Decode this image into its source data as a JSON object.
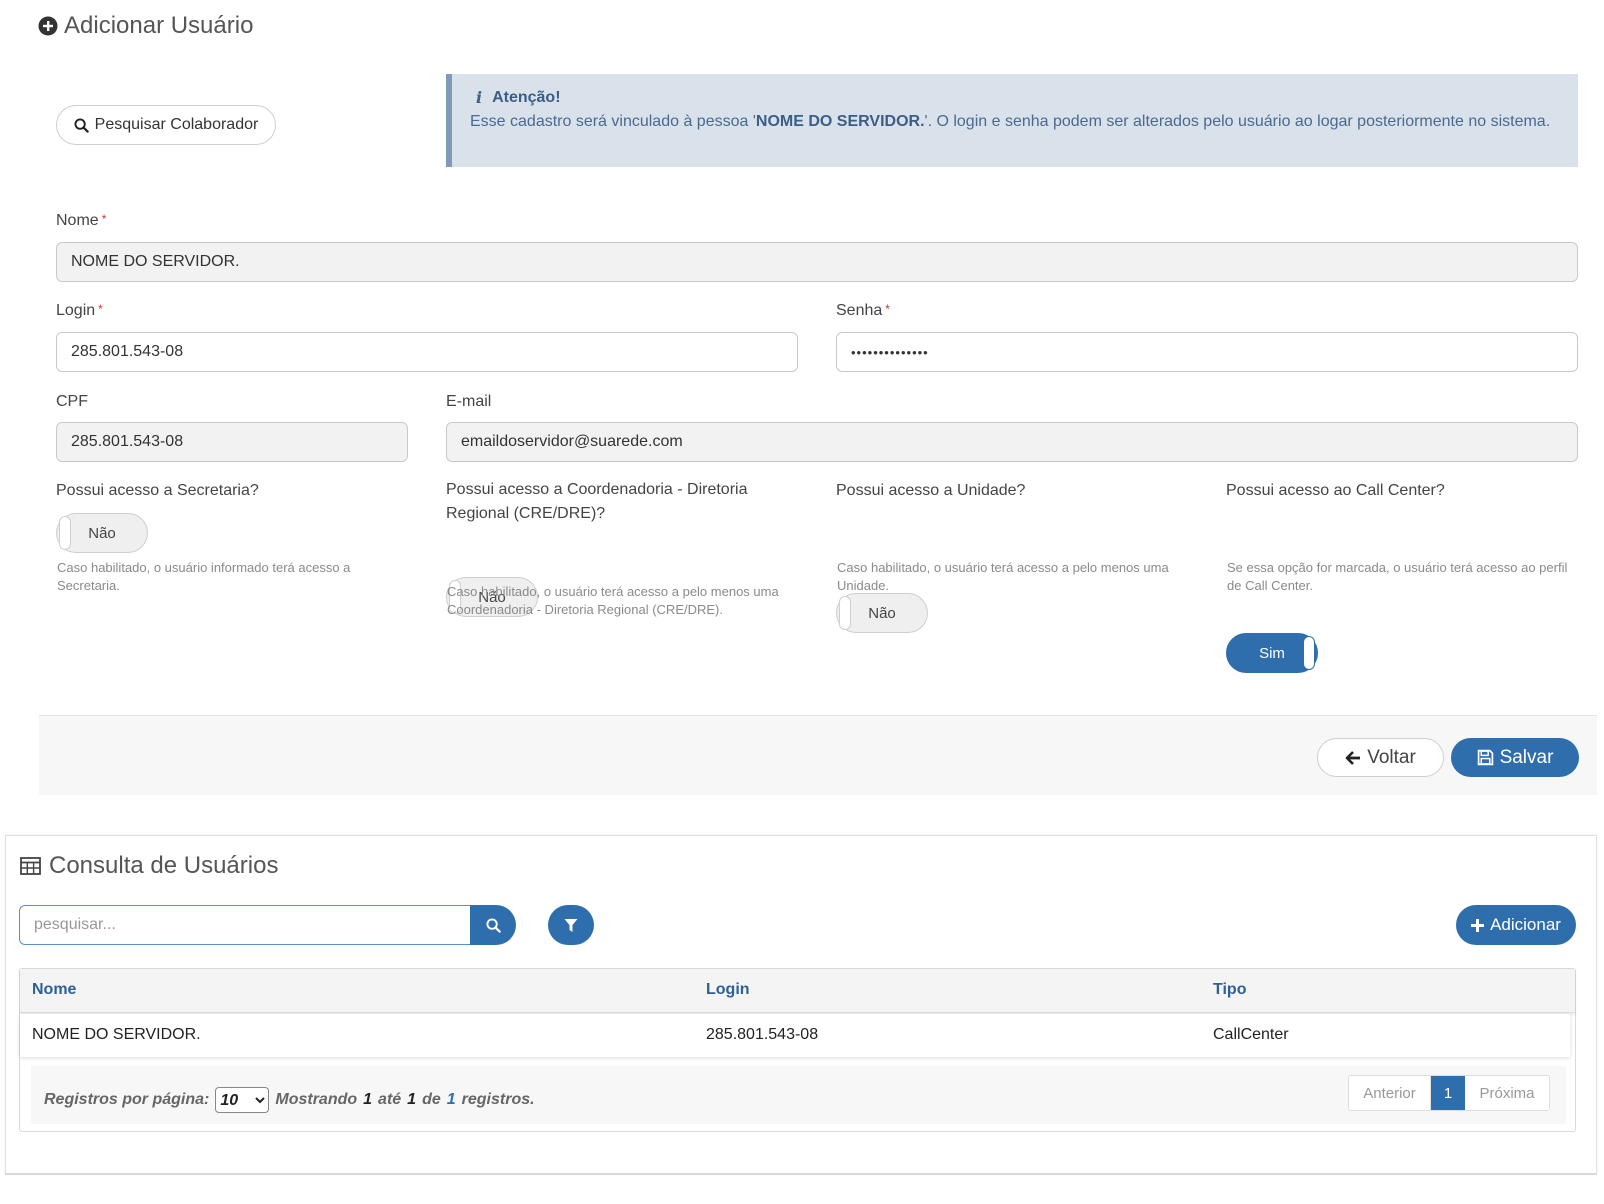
{
  "form": {
    "title": "Adicionar Usuário",
    "search_colab_label": "Pesquisar Colaborador",
    "alert": {
      "title": "Atenção!",
      "text_before": "Esse cadastro será vinculado à pessoa '",
      "name": "NOME DO SERVIDOR.",
      "text_after": "'. O login e senha podem ser alterados pelo usuário ao logar posteriormente no sistema."
    },
    "nome": {
      "label": "Nome",
      "required": "*",
      "value": "NOME DO SERVIDOR."
    },
    "login": {
      "label": "Login",
      "required": "*",
      "value": "285.801.543-08"
    },
    "senha": {
      "label": "Senha",
      "required": "*",
      "value": "••••••••••••••"
    },
    "cpf": {
      "label": "CPF",
      "value": "285.801.543-08"
    },
    "email": {
      "label": "E-mail",
      "value": "emaildoservidor@suarede.com"
    },
    "toggles": [
      {
        "label": "Possui acesso a Secretaria?",
        "state": "Não",
        "help": "Caso habilitado, o usuário informado terá acesso a Secretaria."
      },
      {
        "label": "Possui acesso a Coordenadoria - Diretoria Regional (CRE/DRE)?",
        "state": "Não",
        "help": "Caso habilitado, o usuário terá acesso a pelo menos uma Coordenadoria - Diretoria Regional (CRE/DRE)."
      },
      {
        "label": "Possui acesso a Unidade?",
        "state": "Não",
        "help": "Caso habilitado, o usuário terá acesso a pelo menos uma Unidade."
      },
      {
        "label": "Possui acesso ao Call Center?",
        "state": "Sim",
        "help": "Se essa opção for marcada, o usuário terá acesso ao perfil de Call Center."
      }
    ],
    "voltar_label": "Voltar",
    "salvar_label": "Salvar"
  },
  "consulta": {
    "title": "Consulta de Usuários",
    "search_placeholder": "pesquisar...",
    "add_label": "Adicionar",
    "columns": [
      "Nome",
      "Login",
      "Tipo"
    ],
    "rows": [
      [
        "NOME DO SERVIDOR.",
        "285.801.543-08",
        "CallCenter"
      ]
    ],
    "footer": {
      "rpp_label": "Registros por página:",
      "rpp_value": "10",
      "showing": "Mostrando",
      "from": "1",
      "ate": "até",
      "to": "1",
      "de": "de",
      "total": "1",
      "registros": "registros."
    },
    "pager": {
      "prev": "Anterior",
      "current": "1",
      "next": "Próxima"
    }
  },
  "colors": {
    "primary": "#2f6ead",
    "alert_bg": "#d9e1ea",
    "alert_border": "#7f9ab8",
    "required": "#c0392b"
  },
  "icons": [
    "plus-circle-icon",
    "search-icon",
    "info-icon",
    "arrow-left-icon",
    "save-icon",
    "table-icon",
    "filter-icon",
    "plus-icon"
  ]
}
